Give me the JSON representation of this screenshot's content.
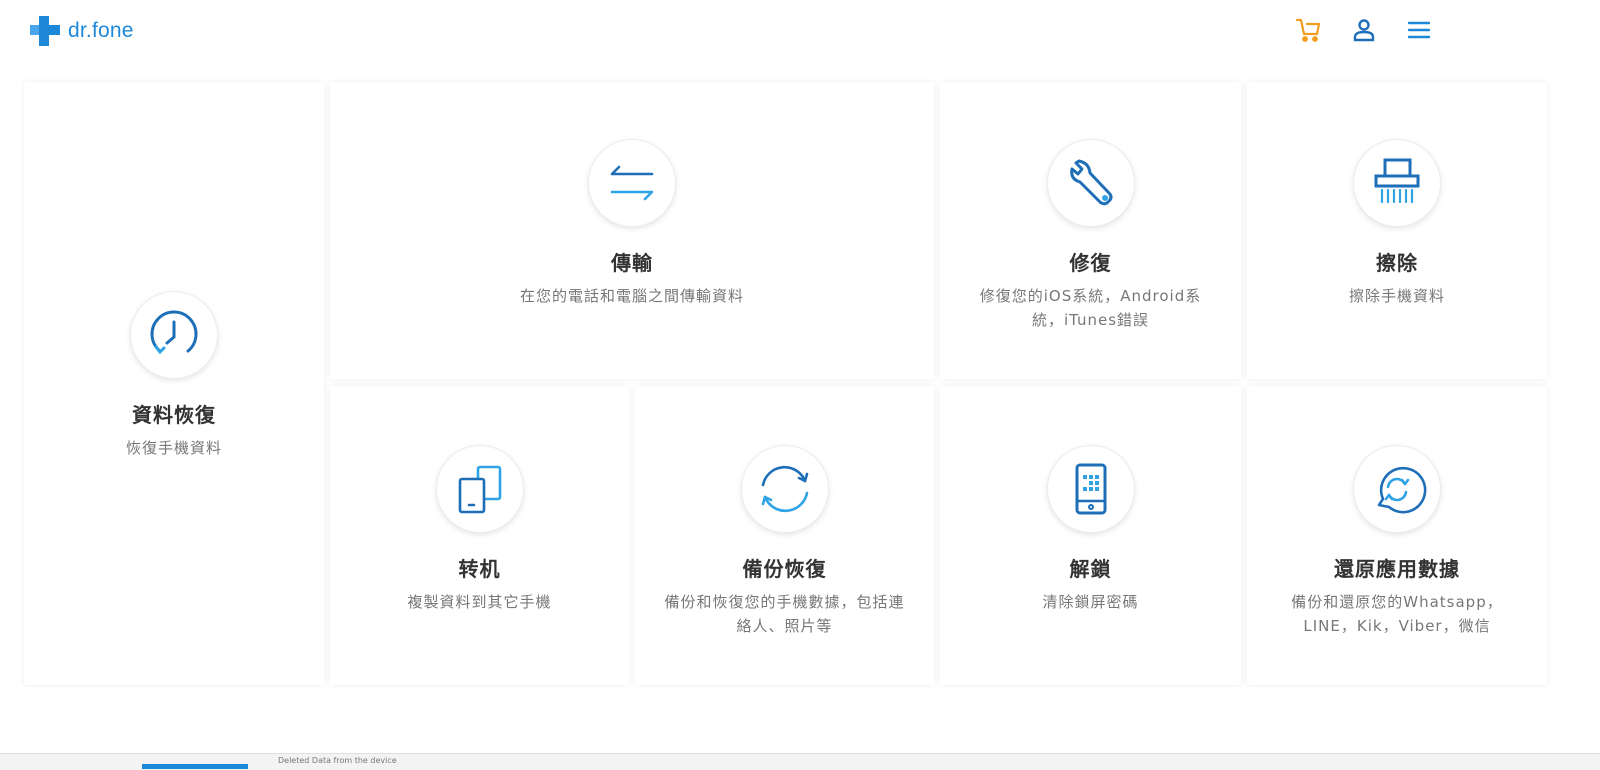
{
  "header": {
    "logo_text": "dr.fone",
    "cart_icon": "cart-icon",
    "user_icon": "user-icon",
    "menu_icon": "menu-icon",
    "colors": {
      "brand": "#1e88d8",
      "cart": "#f39c1f"
    }
  },
  "cards": [
    {
      "id": "data-recovery",
      "title": "資料恢復",
      "desc": "恢復手機資料",
      "icon": "clock-icon"
    },
    {
      "id": "transfer",
      "title": "傳輸",
      "desc": "在您的電話和電腦之間傳輸資料",
      "icon": "transfer-arrows-icon"
    },
    {
      "id": "repair",
      "title": "修復",
      "desc": "修復您的iOS系統，Android系統，iTunes錯誤",
      "icon": "wrench-icon"
    },
    {
      "id": "erase",
      "title": "擦除",
      "desc": "擦除手機資料",
      "icon": "shredder-icon"
    },
    {
      "id": "switch",
      "title": "转机",
      "desc": "複製資料到其它手機",
      "icon": "phone-switch-icon"
    },
    {
      "id": "backup-restore",
      "title": "備份恢復",
      "desc": "備份和恢復您的手機數據，包括連絡人、照片等",
      "icon": "sync-icon"
    },
    {
      "id": "unlock",
      "title": "解鎖",
      "desc": "清除鎖屏密碼",
      "icon": "phone-unlock-icon"
    },
    {
      "id": "restore-app",
      "title": "還原應用數據",
      "desc": "備份和還原您的Whatsapp，LINE，Kik，Viber，微信",
      "icon": "chat-restore-icon"
    }
  ],
  "footer": {
    "partial_text": "Deleted Data from the device"
  }
}
